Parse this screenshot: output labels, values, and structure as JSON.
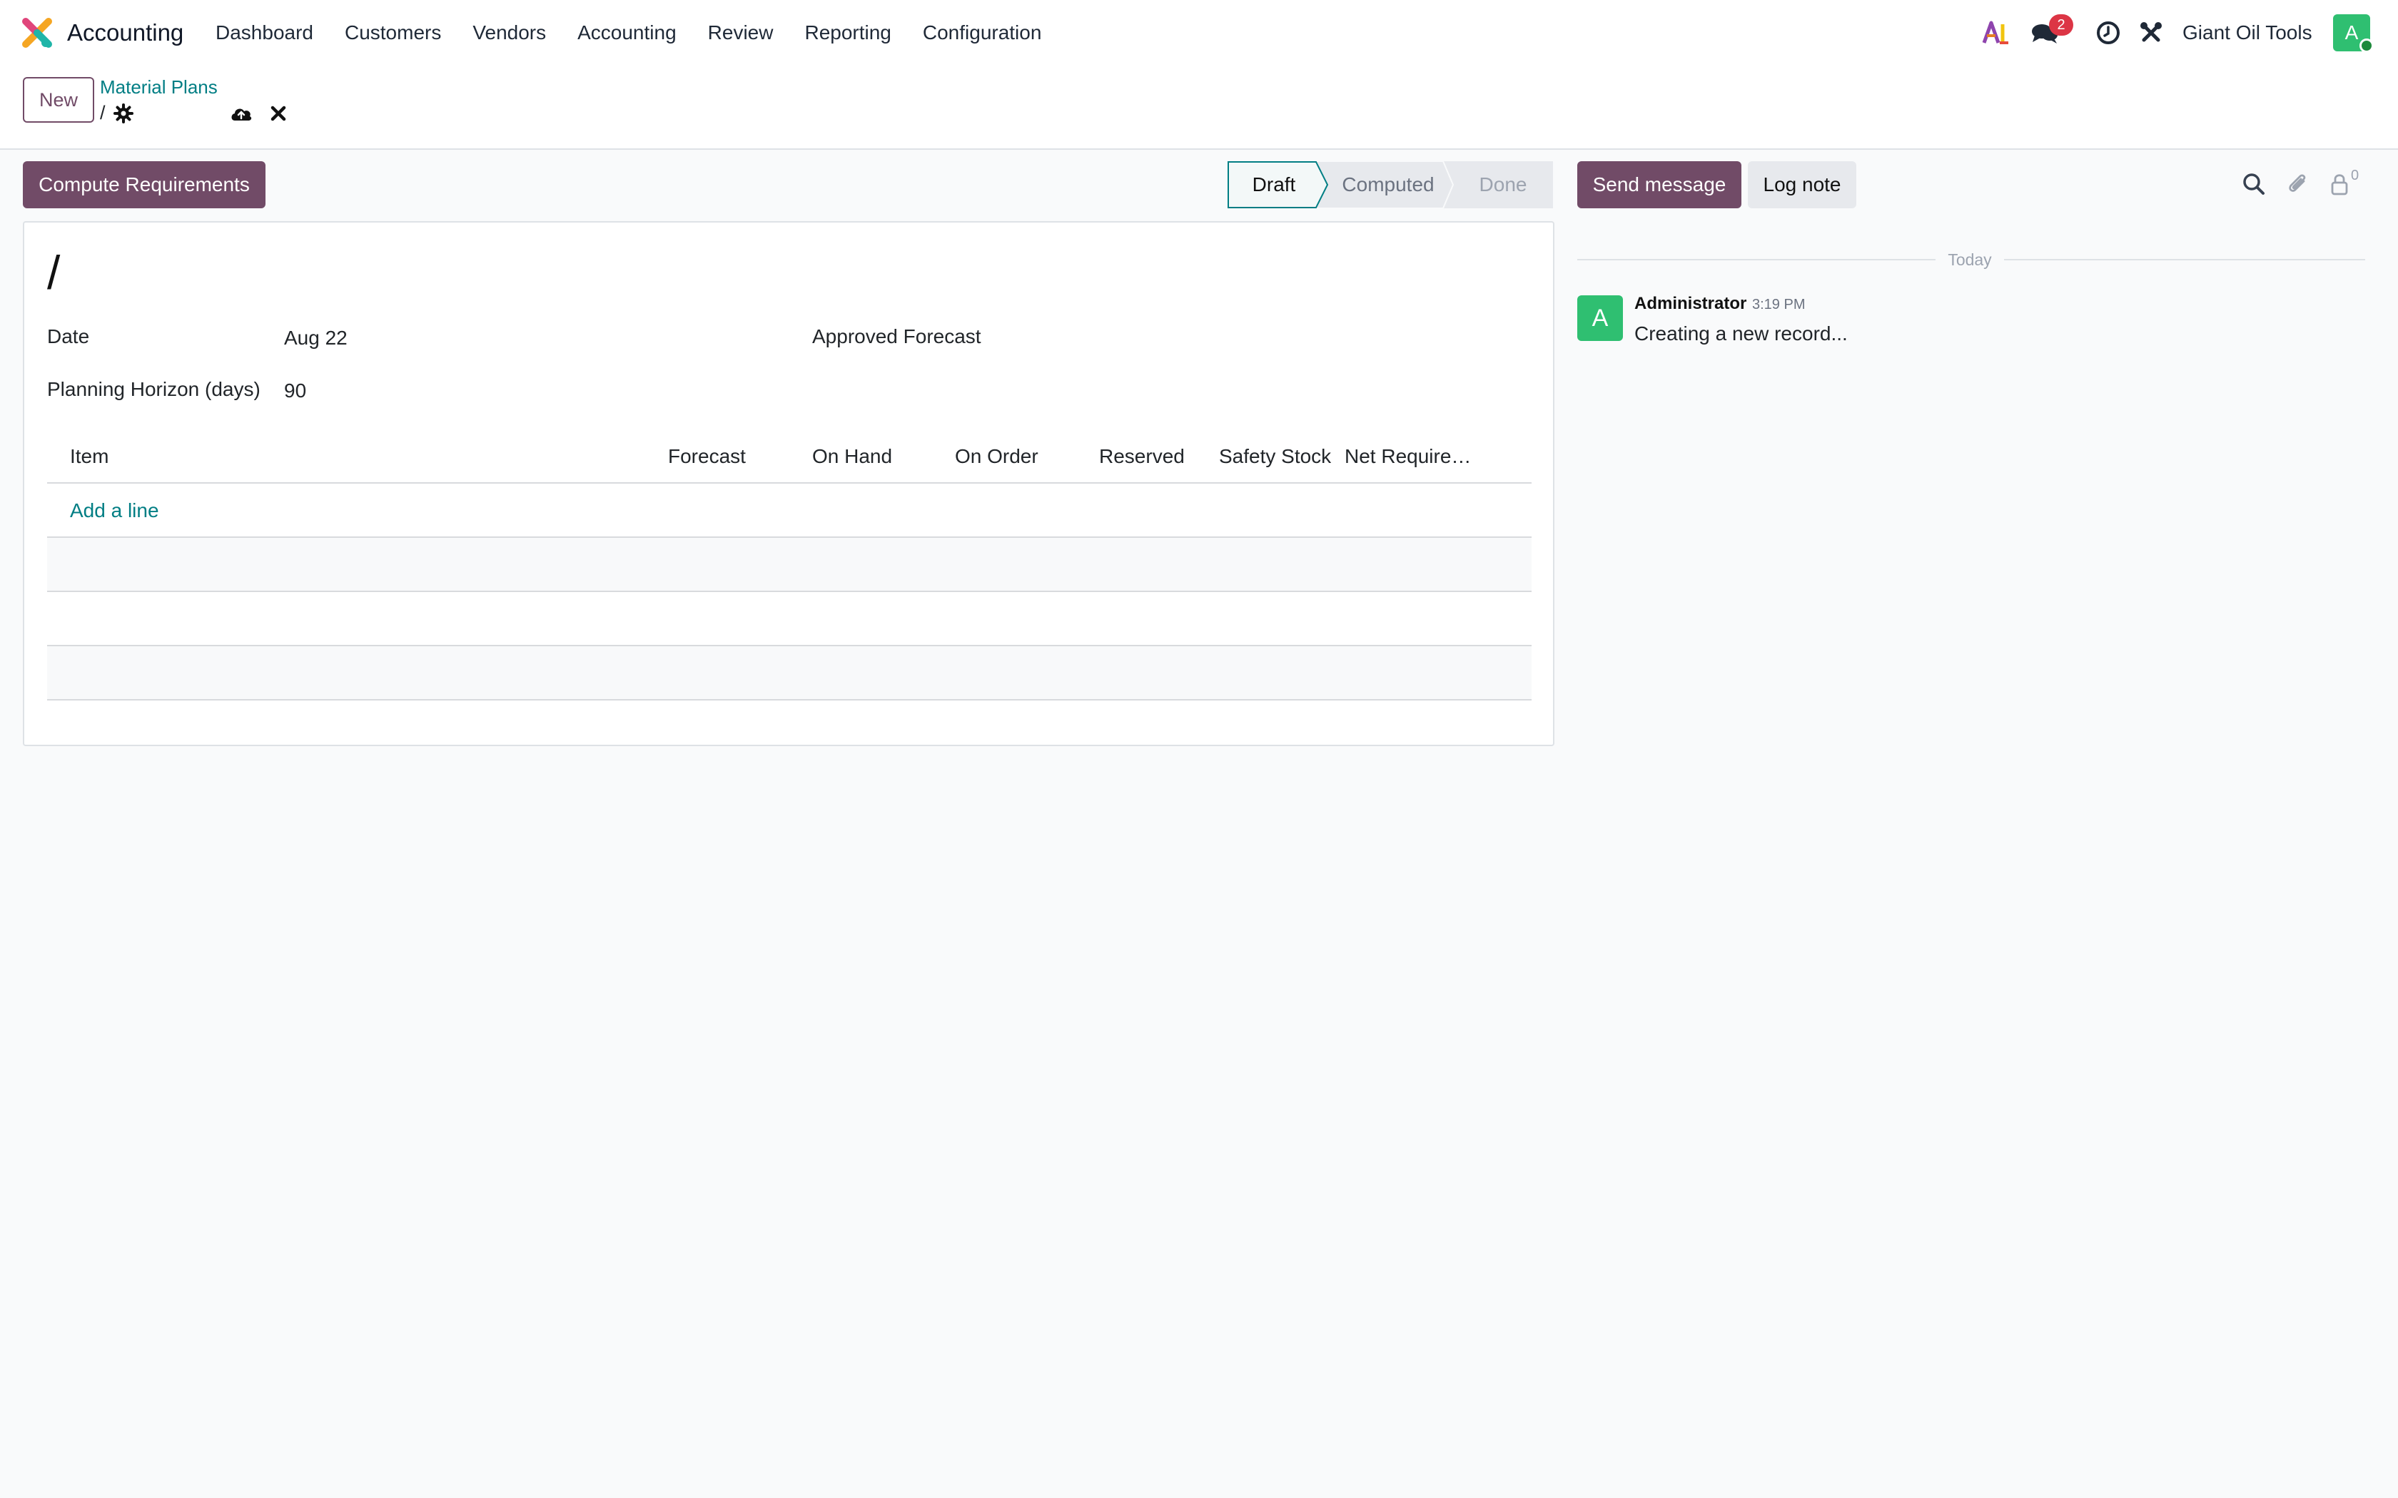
{
  "navbar": {
    "app_name": "Accounting",
    "menu": [
      "Dashboard",
      "Customers",
      "Vendors",
      "Accounting",
      "Review",
      "Reporting",
      "Configuration"
    ],
    "messages_badge": "2",
    "company": "Giant Oil Tools",
    "user_initial": "A"
  },
  "control_panel": {
    "new_label": "New",
    "breadcrumb": "Material Plans",
    "record_name": "/"
  },
  "form": {
    "compute_label": "Compute Requirements",
    "status_steps": [
      "Draft",
      "Computed",
      "Done"
    ],
    "active_status": "Draft",
    "title": "/",
    "date_label": "Date",
    "date_value": "Aug 22",
    "approved_forecast_label": "Approved Forecast",
    "horizon_label": "Planning Horizon (days)",
    "horizon_value": "90",
    "lines": {
      "columns": [
        "Item",
        "Forecast",
        "On Hand",
        "On Order",
        "Reserved",
        "Safety Stock",
        "Net Require…"
      ],
      "add_line": "Add a line"
    }
  },
  "chatter": {
    "send_label": "Send message",
    "log_label": "Log note",
    "followers_count": "0",
    "today_label": "Today",
    "messages": [
      {
        "initial": "A",
        "author": "Administrator",
        "time": "3:19 PM",
        "body": "Creating a new record..."
      }
    ]
  },
  "colors": {
    "brand": "#714b67",
    "link": "#017e84",
    "avatar": "#2fbf71",
    "badge": "#dc3545"
  }
}
